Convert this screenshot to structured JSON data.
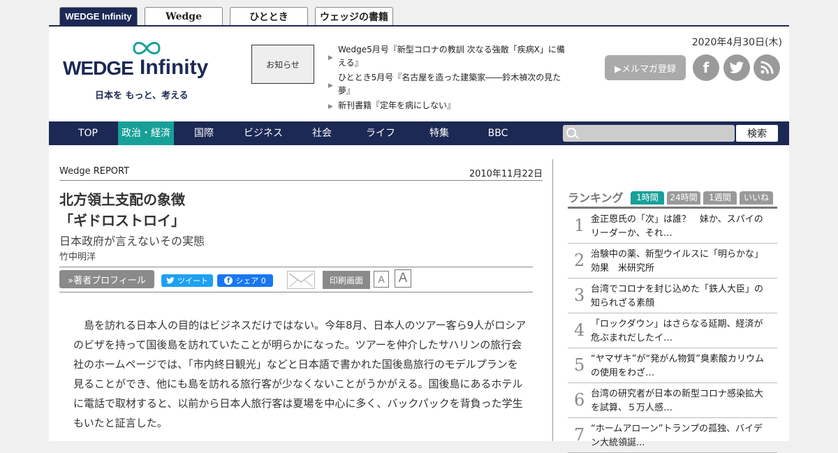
{
  "site_tabs": [
    "WEDGE Infinity",
    "Wedge",
    "ひととき",
    "ウェッジの書籍"
  ],
  "logo": {
    "word1": "WEDGE",
    "word2": "Infinity",
    "tagline": "日本を もっと、考える"
  },
  "notice_label": "お知らせ",
  "news": [
    "Wedge5月号『新型コロナの教訓 次なる強敵「疾病X」に備える』",
    "ひととき5月号『名古屋を造った建築家――鈴木禎次の見た夢』",
    "新刊書籍『定年を病にしない』"
  ],
  "header_date": "2020年4月30日(木)",
  "mailmag_label": "▶メルマガ登録",
  "social_icons": [
    "facebook-icon",
    "twitter-icon",
    "rss-icon"
  ],
  "nav": {
    "items": [
      "TOP",
      "政治・経済",
      "国際",
      "ビジネス",
      "社会",
      "ライフ",
      "特集",
      "BBC"
    ],
    "active_index": 1,
    "search_placeholder": "",
    "search_button": "検索"
  },
  "article": {
    "section": "Wedge REPORT",
    "date": "2010年11月22日",
    "title_line1": "北方領土支配の象徴",
    "title_line2": "「ギドロストロイ」",
    "subtitle": "日本政府が言えないその実態",
    "author": "竹中明洋",
    "profile_button": "»著者プロフィール",
    "tweet_button": "ツイート",
    "share_button": "シェア 0",
    "print_button": "印刷画面",
    "font_small": "A",
    "font_large": "A",
    "body": "島を訪れる日本人の目的はビジネスだけではない。今年8月、日本人のツアー客ら9人がロシアのビザを持って国後島を訪れていたことが明らかになった。ツアーを仲介したサハリンの旅行会社のホームページでは、「市内終日観光」などと日本語で書かれた国後島旅行のモデルプランを見ることができ、他にも島を訪れる旅行客が少なくないことがうかがえる。国後島にあるホテルに電話で取材すると、以前から日本人旅行客は夏場を中心に多く、バックパックを背負った学生もいたと証言した。"
  },
  "ranking": {
    "title": "ランキング",
    "tabs": [
      "1時間",
      "24時間",
      "1週間",
      "いいね"
    ],
    "active_tab": 0,
    "items": [
      {
        "rank": "1",
        "text": "金正恩氏の「次」は誰？　妹か、スパイのリーダーか、それ…"
      },
      {
        "rank": "2",
        "text": "治験中の薬、新型ウイルスに「明らかな」効果　米研究所"
      },
      {
        "rank": "3",
        "text": "台湾でコロナを封じ込めた「鉄人大臣」の知られざる素顔"
      },
      {
        "rank": "4",
        "text": "「ロックダウン」はさらなる延期、経済が危ぶまれだしたイ…"
      },
      {
        "rank": "5",
        "text": "“ヤマザキ”が“発がん物質”臭素酸カリウムの使用をわざ…"
      },
      {
        "rank": "6",
        "text": "台湾の研究者が日本の新型コロナ感染拡大を試算、５万人感…"
      },
      {
        "rank": "7",
        "text": "“ホームアローン”トランプの孤独、バイデン大統領誕..."
      }
    ]
  },
  "colors": {
    "navy": "#1c2955",
    "teal": "#17a098",
    "gray": "#8a8a8a"
  }
}
